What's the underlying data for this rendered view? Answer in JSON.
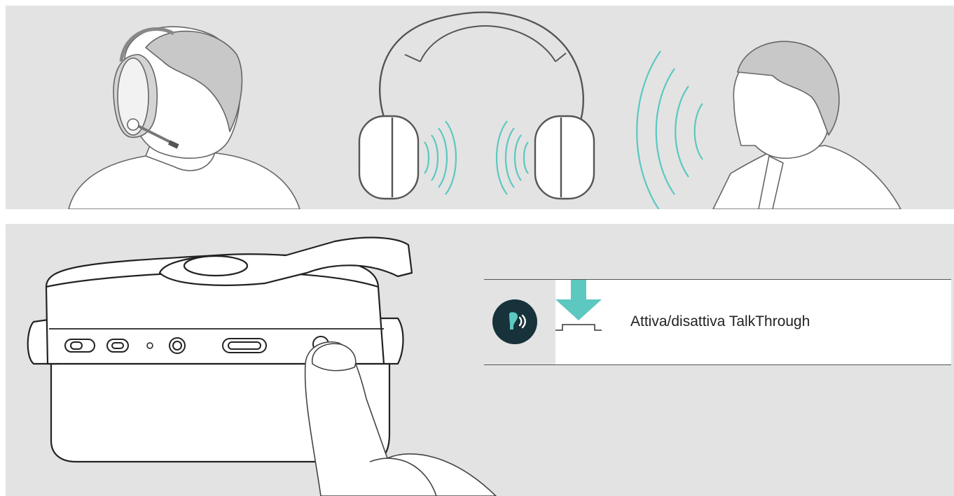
{
  "instruction": {
    "action_label": "Attiva/disattiva TalkThrough",
    "badge_icon": "talkthrough-icon",
    "press_icon": "press-button-arrow-icon"
  },
  "colors": {
    "panel_bg": "#e3e3e3",
    "accent": "#5cc8c0",
    "badge_bg": "#17323a",
    "line": "#555555"
  }
}
